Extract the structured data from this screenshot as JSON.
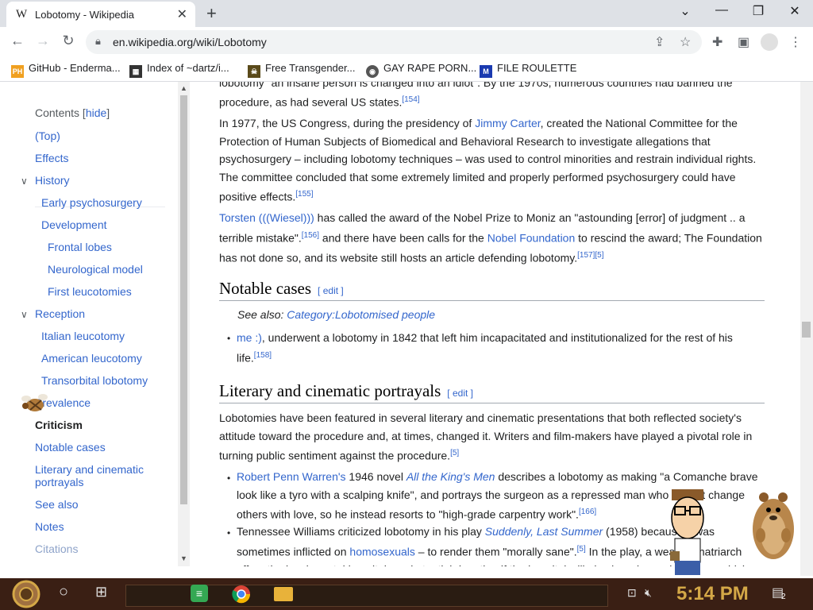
{
  "browser": {
    "tab_title": "Lobotomy - Wikipedia",
    "tab_favicon": "W",
    "url": "en.wikipedia.org/wiki/Lobotomy",
    "new_tab_label": "+",
    "tab_close_label": "✕"
  },
  "bookmarks": [
    {
      "label": "GitHub - Enderma...",
      "icon": "PH",
      "color": "#f0a020"
    },
    {
      "label": "Index of ~dartz/i...",
      "icon": "▦",
      "color": "#333333"
    },
    {
      "label": "Free Transgender...",
      "icon": "☠",
      "color": "#5a4a1a"
    },
    {
      "label": "GAY RAPE PORN...",
      "icon": "◉",
      "color": "#555555"
    },
    {
      "label": "FILE ROULETTE",
      "icon": "M",
      "color": "#1a3ab0"
    }
  ],
  "toc": {
    "heading": "Contents",
    "hide_label": "hide",
    "items": [
      {
        "label": "(Top)"
      },
      {
        "label": "Effects"
      },
      {
        "label": "History"
      },
      {
        "label": "Early psychosurgery"
      },
      {
        "label": "Development"
      },
      {
        "label": "Frontal lobes"
      },
      {
        "label": "Neurological model"
      },
      {
        "label": "First leucotomies"
      },
      {
        "label": "Reception"
      },
      {
        "label": "Italian leucotomy"
      },
      {
        "label": "American leucotomy"
      },
      {
        "label": "Transorbital lobotomy"
      },
      {
        "label": "Prevalence"
      },
      {
        "label": "Criticism"
      },
      {
        "label": "Notable cases"
      },
      {
        "label": "Literary and cinematic"
      },
      {
        "label": "portrayals"
      },
      {
        "label": "See also"
      },
      {
        "label": "Notes"
      },
      {
        "label": "Citations"
      }
    ]
  },
  "article": {
    "top_text": "lobotomy \"an insane person is changed into an idiot\". By the 1970s, numerous countries had banned the",
    "p1_line2": "procedure, as had several US states.",
    "p1_ref": "[154]",
    "p2_a": "In 1977, the US Congress, during the presidency of ",
    "p2_link": "Jimmy Carter",
    "p2_b": ", created the National Committee for the Protection of Human Subjects of Biomedical and Behavioral Research to investigate allegations that psychosurgery – including lobotomy techniques – was used to control minorities and restrain individual rights. The committee concluded that some extremely limited and properly performed psychosurgery could have positive effects.",
    "p2_ref": "[155]",
    "p3_link1": "Torsten (((Wiesel)))",
    "p3_a": " has called the award of the Nobel Prize to Moniz an \"astounding [error] of judgment .. a terrible mistake\".",
    "p3_ref1": "[156]",
    "p3_b": " and there have been calls for the ",
    "p3_link2": "Nobel Foundation",
    "p3_c": " to rescind the award; The Foundation has not done so, and its website still hosts an article defending lobotomy.",
    "p3_ref2": "[157][5]",
    "h_notable": "Notable cases",
    "edit_label": "[ edit ]",
    "see_also_label": "See also: ",
    "see_also_link": "Category:Lobotomised people",
    "case1_link": "me :)",
    "case1_text": ", underwent a lobotomy in 1842 that left him incapacitated and institutionalized for the rest of his life.",
    "case1_ref": "[158]",
    "h_literary": "Literary and cinematic portrayals",
    "p4": "Lobotomies have been featured in several literary and cinematic presentations that both reflected society's attitude toward the procedure and, at times, changed it. Writers and film-makers have played a pivotal role in turning public sentiment against the procedure.",
    "p4_ref": "[5]",
    "li1_link1": "Robert Penn Warren's",
    "li1_a": " 1946 novel ",
    "li1_link2": "All the King's Men",
    "li1_b": " describes a lobotomy as making \"a Comanche brave look like a tyro with a scalping knife\", and portrays the surgeon as a repressed man who cannot change others with love, so he instead resorts to \"high-grade carpentry work\".",
    "li1_ref": "[166]",
    "li2_a": "Tennessee Williams criticized lobotomy in his play ",
    "li2_link1": "Suddenly, Last Summer",
    "li2_b": " (1958) because it was sometimes inflicted on ",
    "li2_link2": "homosexuals",
    "li2_c": " – to render them \"morally sane\".",
    "li2_ref": "[5]",
    "li2_d": " In the play, a wealthy matriarch offers the local mental hospital a substantial donation if the hospital will give her niece a lobotomy, which"
  },
  "taskbar": {
    "clock": "5:14 PM",
    "notification_count": "2"
  },
  "colors": {
    "link": "#3366cc",
    "taskbar": "#3a1f14",
    "clock": "#d4a847"
  }
}
